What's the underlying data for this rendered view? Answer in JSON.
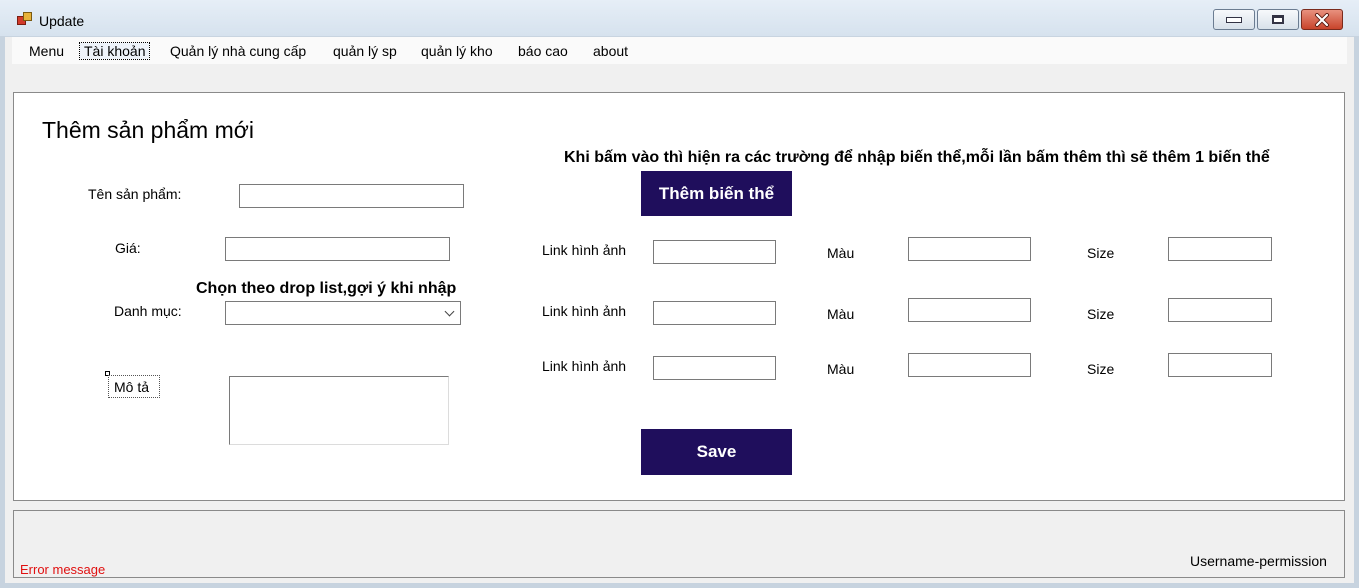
{
  "window": {
    "title": "Update"
  },
  "menu": {
    "items": [
      "Menu",
      "Tài khoản",
      "Quản lý nhà cung cấp",
      "quản lý sp",
      "quản lý kho",
      "báo cao",
      "about"
    ]
  },
  "form": {
    "heading": "Thêm sản phẩm mới",
    "variant_note": "Khi bấm vào thì hiện ra các trường để nhập biến thể,mỗi lần bấm thêm thì sẽ thêm 1 biến thể",
    "dropdown_note": "Chọn theo drop list,gợi ý khi nhập",
    "product_name_label": "Tên sản phẩm:",
    "product_name_value": "",
    "price_label": "Giá:",
    "price_value": "",
    "category_label": "Danh mục:",
    "category_value": "",
    "description_label": "Mô tả",
    "description_value": "",
    "add_variant_button": "Thêm biến thể",
    "save_button": "Save",
    "variants": [
      {
        "image_label": "Link hình ảnh",
        "color_label": "Màu",
        "size_label": "Size",
        "image": "",
        "color": "",
        "size": ""
      },
      {
        "image_label": "Link hình ảnh",
        "color_label": "Màu",
        "size_label": "Size",
        "image": "",
        "color": "",
        "size": ""
      },
      {
        "image_label": "Link hình ảnh",
        "color_label": "Màu",
        "size_label": "Size",
        "image": "",
        "color": "",
        "size": ""
      }
    ]
  },
  "status": {
    "error_message": "Error message",
    "user_permission": "Username-permission"
  },
  "colors": {
    "primary_button": "#1f0e5c",
    "error_text": "#e01010"
  },
  "icons": [
    "app-icon",
    "minimize-icon",
    "maximize-icon",
    "close-icon",
    "chevron-down-icon"
  ]
}
